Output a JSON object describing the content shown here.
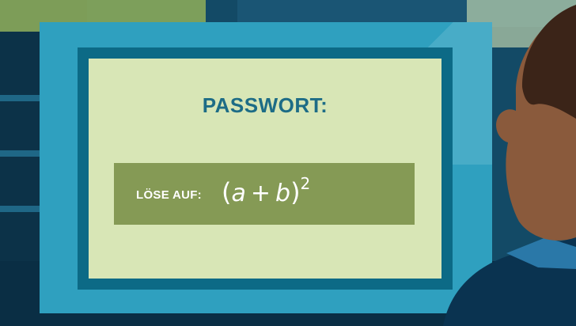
{
  "screen": {
    "title": "PASSWORT:",
    "task_label": "LÖSE AUF:",
    "formula": {
      "open_paren": "(",
      "var_a": "a",
      "operator": "+",
      "var_b": "b",
      "close_paren": ")",
      "exponent": "2"
    }
  },
  "colors": {
    "screen_bg": "#d8e6b6",
    "title_color": "#1d6c86",
    "task_bar": "#859a55",
    "monitor_frame": "#2fa0bf",
    "monitor_bezel": "#0c6a86"
  }
}
